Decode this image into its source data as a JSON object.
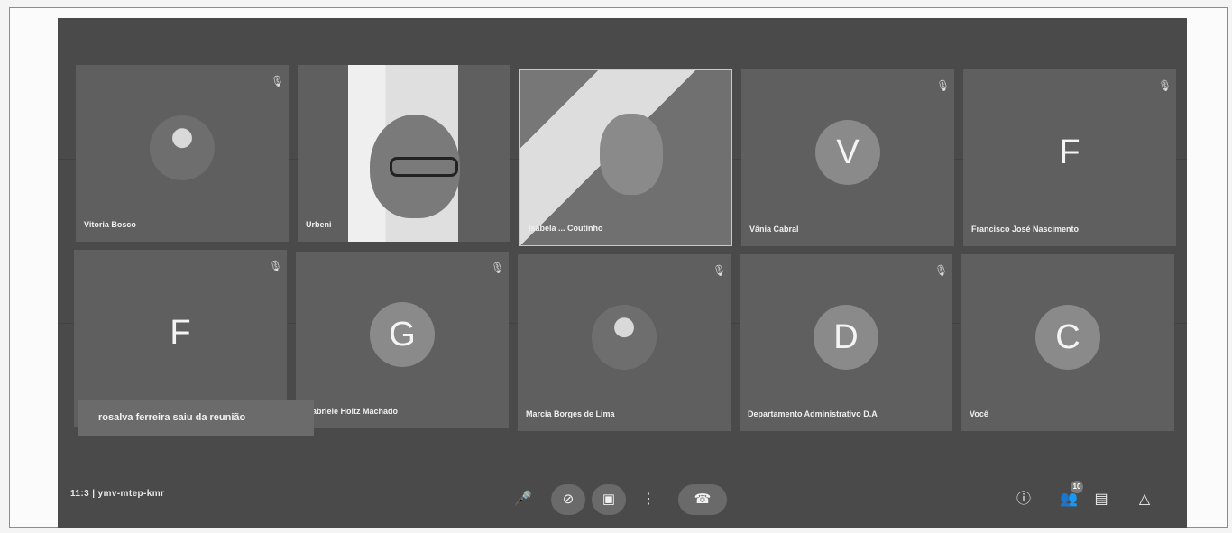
{
  "participants": [
    {
      "name": "Vitoria Bosco",
      "type": "photo",
      "muted_icon": "mic-off-icon"
    },
    {
      "name": "Urbeni",
      "type": "video1",
      "muted_icon": ""
    },
    {
      "name": "Isabela ... Coutinho",
      "type": "video2",
      "muted_icon": "more-options-icon"
    },
    {
      "name": "Vânia Cabral",
      "initial": "V",
      "type": "initial",
      "muted_icon": "mic-off-icon"
    },
    {
      "name": "Francisco José Nascimento",
      "initial": "F",
      "type": "initial-plain",
      "muted_icon": "mic-off-icon"
    },
    {
      "name": "",
      "initial": "F",
      "type": "initial-plain",
      "muted_icon": "mic-off-icon"
    },
    {
      "name": "abriele Holtz Machado",
      "initial": "G",
      "type": "initial",
      "muted_icon": "mic-off-icon"
    },
    {
      "name": "Marcia Borges de Lima",
      "type": "photo",
      "muted_icon": "mic-off-icon"
    },
    {
      "name": "Departamento Administrativo D.A",
      "initial": "D",
      "type": "initial",
      "muted_icon": "mic-off-icon"
    },
    {
      "name": "Você",
      "initial": "C",
      "type": "initial",
      "muted_icon": ""
    }
  ],
  "notification": "rosalva ferreira saiu da reunião",
  "meeting_code": "11:3 | ymv-mtep-kmr",
  "controls": {
    "mic": "mic-icon",
    "camera": "camera-off-icon",
    "present": "present-icon",
    "more": "more-icon",
    "hangup": "phone-hangup-icon"
  },
  "right_controls": {
    "info": "info-icon",
    "people": "people-icon",
    "people_count": "10",
    "chat": "chat-icon",
    "activities": "shapes-icon"
  }
}
